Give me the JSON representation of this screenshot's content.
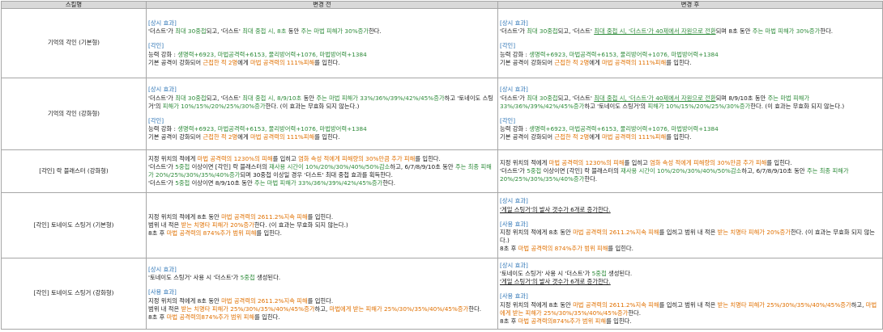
{
  "header": {
    "col_name": "스킬명",
    "col_before": "변경 전",
    "col_after": "변경 후"
  },
  "rows": [
    {
      "name": "기억의 각인 (기본형)",
      "before": [
        [
          {
            "t": "[상시 효과]",
            "c": "sec"
          }
        ],
        [
          {
            "t": "'더스트'가 "
          },
          {
            "t": "최대 30중첩",
            "c": "g"
          },
          {
            "t": "되고, '더스트' "
          },
          {
            "t": "최대 중첩 시, 8초",
            "c": "g"
          },
          {
            "t": " 동안 "
          },
          {
            "t": "주는 마법 피해가 30%증가",
            "c": "g"
          },
          {
            "t": "한다."
          }
        ],
        [],
        [
          {
            "t": "[각인]",
            "c": "sec"
          }
        ],
        [
          {
            "t": "능력 강화 : "
          },
          {
            "t": "생명력+6923, 마법공격력+6153, 물리방어력+1076, 마법방어력+1384",
            "c": "g"
          }
        ],
        [
          {
            "t": "기본 공격이 강화되어 "
          },
          {
            "t": "근접한 적 2명",
            "c": "o"
          },
          {
            "t": "에게 "
          },
          {
            "t": "마법 공격력의 111%피해",
            "c": "o"
          },
          {
            "t": "를 입힌다."
          }
        ]
      ],
      "after": [
        [
          {
            "t": "[상시 효과]",
            "c": "sec"
          }
        ],
        [
          {
            "t": "'더스트'가 "
          },
          {
            "t": "최대 30중첩",
            "c": "g"
          },
          {
            "t": "되고, '더스트' "
          },
          {
            "t": "최대 중첩 시, '더스트'가 40제에서 자원으로 전환",
            "c": "g u"
          },
          {
            "t": "되며 8초 동안 "
          },
          {
            "t": "주는 마법 피해가 30%증가",
            "c": "g"
          },
          {
            "t": "한다."
          }
        ],
        [],
        [
          {
            "t": "[각인]",
            "c": "sec"
          }
        ],
        [
          {
            "t": "능력 강화 : "
          },
          {
            "t": "생명력+6923, 마법공격력+6153, 물리방어력+1076, 마법방어력+1384",
            "c": "g"
          }
        ],
        [
          {
            "t": "기본 공격이 강화되어 "
          },
          {
            "t": "근접한 적 2명",
            "c": "o"
          },
          {
            "t": "에게 "
          },
          {
            "t": "마법 공격력의 111%피해",
            "c": "o"
          },
          {
            "t": "를 입힌다."
          }
        ]
      ]
    },
    {
      "name": "기억의 각인 (강화형)",
      "before": [
        [
          {
            "t": "[상시 효과]",
            "c": "sec"
          }
        ],
        [
          {
            "t": "'더스트'가 "
          },
          {
            "t": "최대 30중첩",
            "c": "g"
          },
          {
            "t": "되고, '더스트' "
          },
          {
            "t": "최대 중첩 시, 8/9/10초",
            "c": "g"
          },
          {
            "t": " 동안 "
          },
          {
            "t": "주는 마법 피해가 33%/36%/39%/42%/45%증가",
            "c": "g"
          },
          {
            "t": "하고 '토네이도 스팅거'의 "
          },
          {
            "t": "피해가 10%/15%/20%/25%/30%증가",
            "c": "g"
          },
          {
            "t": "한다. (이 효과는 무효화 되지 않는다.)"
          }
        ],
        [],
        [
          {
            "t": "[각인]",
            "c": "sec"
          }
        ],
        [
          {
            "t": "능력 강화 : "
          },
          {
            "t": "생명력+6923, 마법공격력+6153, 물리방어력+1076, 마법방어력+1384",
            "c": "g"
          }
        ],
        [
          {
            "t": "기본 공격이 강화되어 "
          },
          {
            "t": "근접한 적 2명",
            "c": "o"
          },
          {
            "t": "에게 "
          },
          {
            "t": "마법 공격력의 111%피해",
            "c": "o"
          },
          {
            "t": "를 입힌다."
          }
        ]
      ],
      "after": [
        [
          {
            "t": "[상시 효과]",
            "c": "sec"
          }
        ],
        [
          {
            "t": "'더스트'가 "
          },
          {
            "t": "최대 30중첩",
            "c": "g"
          },
          {
            "t": "되고, '더스트' "
          },
          {
            "t": "최대 중첩 시, '더스트'가 40제에서 자원으로 전환",
            "c": "g u"
          },
          {
            "t": "되며 8/9/10초 동안 "
          },
          {
            "t": "주는 마법 피해가 33%/36%/39%/42%/45%증가",
            "c": "g"
          },
          {
            "t": "하고 '토네이도 스팅거'의 "
          },
          {
            "t": "피해가 10%/15%/20%/25%/30%증가",
            "c": "g"
          },
          {
            "t": "한다. (이 효과는 무효화 되지 않는다.)"
          }
        ],
        [],
        [
          {
            "t": "[각인]",
            "c": "sec"
          }
        ],
        [
          {
            "t": "능력 강화 : "
          },
          {
            "t": "생명력+6923, 마법공격력+6153, 물리방어력+1076, 마법방어력+1384",
            "c": "g"
          }
        ],
        [
          {
            "t": "기본 공격이 강화되어 "
          },
          {
            "t": "근접한 적 2명",
            "c": "o"
          },
          {
            "t": "에게 "
          },
          {
            "t": "마법 공격력의 111%피해",
            "c": "o"
          },
          {
            "t": "를 입힌다."
          }
        ]
      ]
    },
    {
      "name": "[각인] 락 블래스터 (강화형)",
      "before": [
        [
          {
            "t": "지정 위치의 적에게 "
          },
          {
            "t": "마법 공격력의 1230%의 피해",
            "c": "o"
          },
          {
            "t": "를 입히고 "
          },
          {
            "t": "염화 속성 적에게 피해량의 30%만큼 추가 피해",
            "c": "o"
          },
          {
            "t": "를 입힌다."
          }
        ],
        [
          {
            "t": "'더스트'가 "
          },
          {
            "t": "5중첩",
            "c": "g"
          },
          {
            "t": " 이상이면 [각인] 락 블래스터의 "
          },
          {
            "t": "재사용 시간이 10%/20%/30%/40%/50%감소",
            "c": "g"
          },
          {
            "t": "하고, 6/7/8/9/10초 동안 "
          },
          {
            "t": "주는 최종 피해가 20%/25%/30%/35%/40%증가",
            "c": "g"
          },
          {
            "t": "되며 30중첩 이상일 경우 '더스트' 최대 중첩 효과를 획득한다."
          }
        ],
        [
          {
            "t": "'더스트'가 "
          },
          {
            "t": "5중첩",
            "c": "g"
          },
          {
            "t": " 이상이면 8/9/10초 동안 "
          },
          {
            "t": "주는 마법 피해가 33%/36%/39%/42%/45%증가",
            "c": "g"
          },
          {
            "t": "한다."
          }
        ]
      ],
      "after": [
        [
          {
            "t": "지정 위치의 적에게 "
          },
          {
            "t": "마법 공격력의 1230%의 피해",
            "c": "o"
          },
          {
            "t": "를 입히고 "
          },
          {
            "t": "염화 속성 적에게 피해량의 30%만큼 추가 피해",
            "c": "o"
          },
          {
            "t": "를 입힌다."
          }
        ],
        [
          {
            "t": "'더스트'가 "
          },
          {
            "t": "5중첩",
            "c": "g"
          },
          {
            "t": " 이상이면 [각인] 락 블래스터의 "
          },
          {
            "t": "재사용 시간이 10%/20%/30%/40%/50%감소",
            "c": "g"
          },
          {
            "t": "하고, 6/7/8/9/10초 동안 "
          },
          {
            "t": "주는 최종 피해가 20%/25%/30%/35%/40%증가",
            "c": "g"
          },
          {
            "t": "한다."
          }
        ]
      ]
    },
    {
      "name": "[각인] 토네이도 스팅거 (기본형)",
      "before": [
        [
          {
            "t": "지정 위치의 적에게 8초 동안 "
          },
          {
            "t": "마법 공격력의 2611.2%지속 피해",
            "c": "o"
          },
          {
            "t": "를 입힌다."
          }
        ],
        [
          {
            "t": "범위 내 적은 "
          },
          {
            "t": "받는 치명타 피해가 20%증가",
            "c": "o"
          },
          {
            "t": "한다. (이 효과는 무효화 되지 않는다.)"
          }
        ],
        [
          {
            "t": "8초 후 "
          },
          {
            "t": "마법 공격력의 874%추가 범위 피해",
            "c": "o"
          },
          {
            "t": "를 입힌다."
          }
        ]
      ],
      "after": [
        [
          {
            "t": "[상시 효과]",
            "c": "sec"
          }
        ],
        [
          {
            "t": "'게일 스팅거'의 발사 갯수가 6개로 증가한다.",
            "c": "u"
          }
        ],
        [],
        [
          {
            "t": "[사용 효과]",
            "c": "sec"
          }
        ],
        [
          {
            "t": "지정 위치의 적에게 8초 동안 "
          },
          {
            "t": "마법 공격력의 2611.2%지속 피해",
            "c": "o"
          },
          {
            "t": "를 입히고 범위 내 적은 "
          },
          {
            "t": "받는 치명타 피해가 20%증가",
            "c": "o"
          },
          {
            "t": "한다. (이 효과는 무효화 되지 않는다.)"
          }
        ],
        [
          {
            "t": "8초 후 "
          },
          {
            "t": "마법 공격력의 874%추가 범위 피해",
            "c": "o"
          },
          {
            "t": "를 입힌다."
          }
        ]
      ]
    },
    {
      "name": "[각인] 토네이도 스팅거 (강화형)",
      "before": [
        [
          {
            "t": "[상시 효과]",
            "c": "sec"
          }
        ],
        [
          {
            "t": "'토네이도 스팅거' 사용 시 '더스트'가 "
          },
          {
            "t": "5중첩",
            "c": "g"
          },
          {
            "t": " 생성된다."
          }
        ],
        [],
        [
          {
            "t": "[사용 효과]",
            "c": "sec"
          }
        ],
        [
          {
            "t": "지정 위치의 적에게 8초 동안 "
          },
          {
            "t": "마법 공격력의 2611.2%지속 피해",
            "c": "o"
          },
          {
            "t": "를 입힌다."
          }
        ],
        [
          {
            "t": "범위 내 적은 "
          },
          {
            "t": "받는 치명타 피해가 25%/30%/35%/40%/45%증가",
            "c": "o"
          },
          {
            "t": "하고, "
          },
          {
            "t": "마법에게 받는 피해가 25%/30%/35%/40%/45%증가",
            "c": "o"
          },
          {
            "t": "한다."
          }
        ],
        [
          {
            "t": "8초 후 "
          },
          {
            "t": "마법 공격력의874%추가 범위 피해",
            "c": "o"
          },
          {
            "t": "를 입힌다."
          }
        ]
      ],
      "after": [
        [
          {
            "t": "[상시 효과]",
            "c": "sec"
          }
        ],
        [
          {
            "t": "'토네이도 스팅거' 사용 시 '더스트'가 "
          },
          {
            "t": "5중첩",
            "c": "g"
          },
          {
            "t": " 생성된다."
          }
        ],
        [
          {
            "t": "'게일 스팅거'의 발사 갯수가 6개로 증가한다.",
            "c": "u"
          }
        ],
        [],
        [
          {
            "t": "[사용 효과]",
            "c": "sec"
          }
        ],
        [
          {
            "t": "지정 위치의 적에게 8초 동안 "
          },
          {
            "t": "마법 공격력의 2611.2%지속 피해",
            "c": "o"
          },
          {
            "t": "를 입히고 범위 내 적은 "
          },
          {
            "t": "받는 치명타 피해가 25%/30%/35%/40%/45%증가",
            "c": "o"
          },
          {
            "t": "하고, "
          },
          {
            "t": "마법에게 받는 피해가 25%/30%/35%/40%/45%증가",
            "c": "o"
          },
          {
            "t": "한다."
          }
        ],
        [
          {
            "t": "8초 후 "
          },
          {
            "t": "마법 공격력의874%추가 범위 피해",
            "c": "o"
          },
          {
            "t": "를 입힌다."
          }
        ]
      ]
    }
  ]
}
